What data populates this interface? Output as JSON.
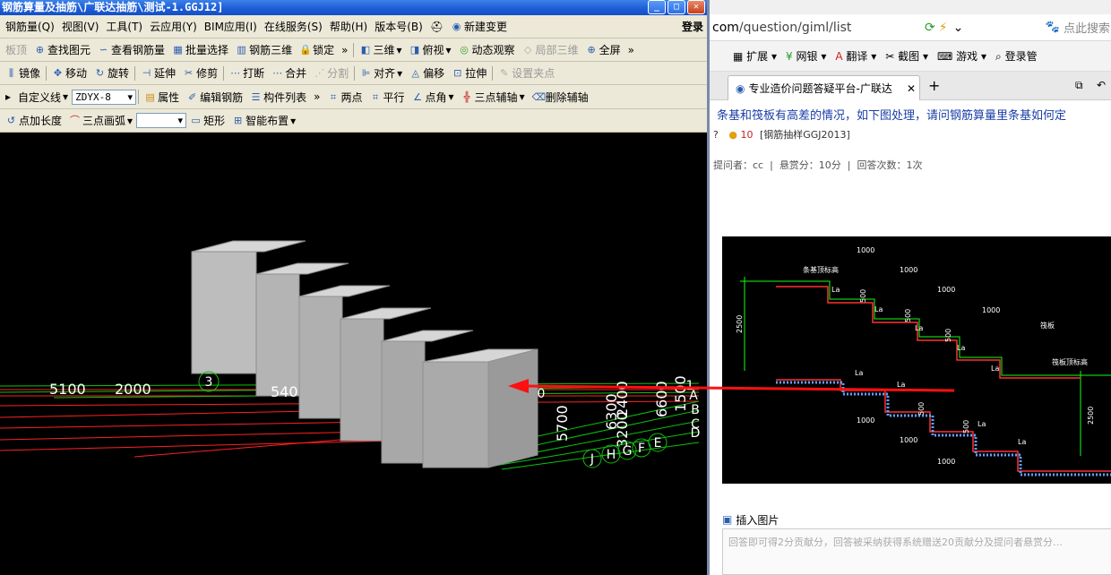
{
  "titlebar": {
    "text": "钢筋算量及抽筋\\广联达抽筋\\测试-1.GGJ12]"
  },
  "menubar": {
    "items": [
      "钢筋量(Q)",
      "视图(V)",
      "工具(T)",
      "云应用(Y)",
      "BIM应用(I)",
      "在线服务(S)",
      "帮助(H)",
      "版本号(B)",
      "新建变更"
    ],
    "login": "登录"
  },
  "toolbar1": {
    "items": [
      "板顶",
      "查找图元",
      "查看钢筋量",
      "批量选择",
      "钢筋三维",
      "锁定",
      "三维",
      "俯视",
      "动态观察",
      "局部三维",
      "全屏"
    ]
  },
  "toolbar2": {
    "items": [
      "镜像",
      "移动",
      "旋转",
      "延伸",
      "修剪",
      "打断",
      "合并",
      "分割",
      "对齐",
      "偏移",
      "拉伸",
      "设置夹点"
    ]
  },
  "toolbar3": {
    "custom_line": "自定义线",
    "zdyx_value": "ZDYX-8",
    "items": [
      "属性",
      "编辑钢筋",
      "构件列表",
      "两点",
      "平行",
      "点角",
      "三点辅轴",
      "删除辅轴"
    ]
  },
  "toolbar4": {
    "items": [
      "点加长度",
      "三点画弧",
      "矩形",
      "智能布置"
    ]
  },
  "viewport": {
    "dims": [
      "5100",
      "2000",
      "540",
      "5700",
      "6300",
      "3200",
      "2400",
      "6600",
      "1500"
    ],
    "axis_labels": [
      "3",
      "A",
      "B",
      "C",
      "D",
      "E",
      "F",
      "G",
      "H",
      "J",
      "1",
      "0"
    ]
  },
  "browser": {
    "url_prefix": "com",
    "url_path": "/question/giml/list",
    "search_placeholder": "点此搜索",
    "toolbar": [
      "扩展",
      "网银",
      "翻译",
      "截图",
      "游戏",
      "登录管"
    ],
    "tab_title": "专业造价问题答疑平台-广联达",
    "question_title": "条基和筏板有高差的情况，如下图处理，请问钢筋算量里条基如何定",
    "question_mark": "?",
    "reward": "10",
    "category": "[钢筋抽样GGJ2013]",
    "asker": "提问者：cc",
    "bounty": "悬赏分：10分",
    "answers": "回答次数：1次",
    "insert_image": "插入图片",
    "answer_placeholder": "回答即可得2分贡献分，回答被采纳获得系统赠送20贡献分及提问者悬赏分…"
  },
  "cad": {
    "dim_1000": "1000",
    "dim_500": "500",
    "dim_2500": "2500",
    "label_la": "La",
    "label_strip": "条基顶标高",
    "label_raft": "筏板",
    "label_raft_top": "筏板顶标高"
  },
  "colors": {
    "arrow": "#ff1010",
    "rebar": "#ff2020",
    "dim": "#10ff10"
  }
}
